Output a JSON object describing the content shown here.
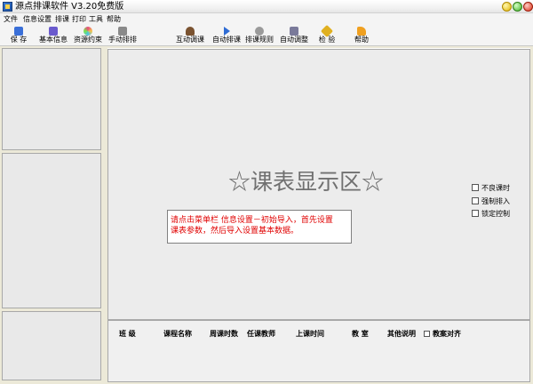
{
  "window": {
    "title": "源点排课软件 V3.20免费版"
  },
  "menu": [
    "文件",
    "信息设置",
    "排课",
    "打印",
    "工具",
    "帮助"
  ],
  "toolbar": [
    {
      "label": "保  存",
      "icon": "save-icon",
      "color": "#3a6fd8"
    },
    {
      "label": "基本信息",
      "icon": "info-icon",
      "color": "#6a5acd"
    },
    {
      "label": "资源约束",
      "icon": "palette-icon",
      "color": "#e84a7f"
    },
    {
      "label": "手动排排",
      "icon": "manual-icon",
      "color": "#8a8a8a"
    },
    {
      "label": "互动调课",
      "icon": "user-icon",
      "color": "#7a5230"
    },
    {
      "label": "自动排课",
      "icon": "play-icon",
      "color": "#2e6bd4"
    },
    {
      "label": "排课规则",
      "icon": "gear-icon",
      "color": "#9a9a9a"
    },
    {
      "label": "自动调整",
      "icon": "adjust-icon",
      "color": "#7a7a9a"
    },
    {
      "label": "检  验",
      "icon": "check-icon",
      "color": "#e0b020"
    },
    {
      "label": "帮助",
      "icon": "help-icon",
      "color": "#f0a020"
    }
  ],
  "main": {
    "watermark": "☆课表显示区☆",
    "notice_line1": "请点击菜单栏 信息设置－初始导入，首先设置",
    "notice_line2": "课表参数，然后导入设置基本数据。"
  },
  "side_options": [
    "不良课时",
    "强制排入",
    "锁定控制"
  ],
  "detail": {
    "columns": [
      "班    级",
      "课程名称",
      "周课时数",
      "任课教师",
      "上课时间",
      "教    室",
      "其他说明"
    ],
    "checkbox_label": "教案对齐"
  }
}
